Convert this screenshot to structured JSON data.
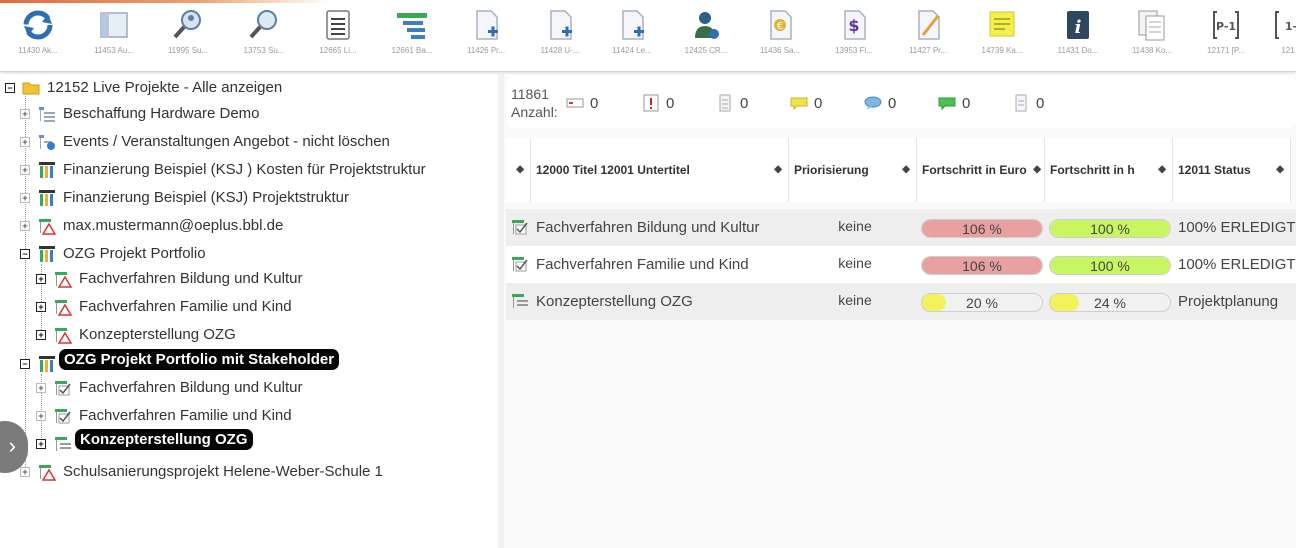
{
  "toolbar": {
    "buttons": [
      {
        "label": "11430 Ak...",
        "icon": "refresh-icon"
      },
      {
        "label": "11453 Au...",
        "icon": "window-icon"
      },
      {
        "label": "11995 Su...",
        "icon": "search-user-icon"
      },
      {
        "label": "13753 Su...",
        "icon": "search-icon"
      },
      {
        "label": "12665 Li...",
        "icon": "list-icon"
      },
      {
        "label": "12661 Ba...",
        "icon": "gantt-icon"
      },
      {
        "label": "11426 Pr...",
        "icon": "new-document-icon"
      },
      {
        "label": "11428 U-...",
        "icon": "new-document-icon"
      },
      {
        "label": "11424 Le...",
        "icon": "new-document-icon"
      },
      {
        "label": "12425 CR...",
        "icon": "user-add-icon"
      },
      {
        "label": "11436 Sa...",
        "icon": "euro-document-icon"
      },
      {
        "label": "13953 Fi...",
        "icon": "dollar-document-icon"
      },
      {
        "label": "11427 Pr...",
        "icon": "edit-document-icon"
      },
      {
        "label": "14739 Ka...",
        "icon": "sticky-note-icon"
      },
      {
        "label": "11431 Do...",
        "icon": "info-icon"
      },
      {
        "label": "11438 Ko...",
        "icon": "copy-documents-icon"
      },
      {
        "label": "12171 [P...",
        "icon": "p-1-icon"
      },
      {
        "label": "121",
        "icon": "bracket-icon"
      }
    ],
    "p1_text": "P-1",
    "bracket_text": "1-"
  },
  "tree": {
    "root": "12152 Live Projekte - Alle anzeigen",
    "items": [
      {
        "label": "Beschaffung Hardware Demo"
      },
      {
        "label": "Events / Veranstaltungen Angebot - nicht löschen"
      },
      {
        "label": "Finanzierung Beispiel (KSJ ) Kosten für Projektstruktur"
      },
      {
        "label": "Finanzierung Beispiel (KSJ) Projektstruktur"
      },
      {
        "label": "max.mustermann@oeplus.bbl.de"
      },
      {
        "label": "OZG Projekt Portfolio"
      },
      {
        "label": "Fachverfahren Bildung und Kultur"
      },
      {
        "label": "Fachverfahren Familie und Kind"
      },
      {
        "label": "Konzepterstellung OZG"
      },
      {
        "label": "OZG Projekt Portfolio mit Stakeholder"
      },
      {
        "label": "Fachverfahren Bildung und Kultur"
      },
      {
        "label": "Fachverfahren Familie und Kind"
      },
      {
        "label": "Konzepterstellung OZG"
      },
      {
        "label": "Schulsanierungsprojekt Helene-Weber-Schule 1"
      }
    ]
  },
  "summary": {
    "id": "11861",
    "count_label": "Anzahl:",
    "counts": [
      "0",
      "0",
      "0",
      "0",
      "0",
      "0",
      "0"
    ]
  },
  "grid": {
    "headers": [
      "12000 Titel 12001 Untertitel",
      "Priorisierung",
      "Fortschritt in Euro",
      "Fortschritt in h",
      "12011 Status"
    ],
    "rows": [
      {
        "title": "Fachverfahren Bildung und Kultur",
        "prio": "keine",
        "euro": "106 %",
        "euro_value": 106,
        "hours": "100 %",
        "hours_value": 100,
        "status": "100% ERLEDIGT"
      },
      {
        "title": "Fachverfahren Familie und Kind",
        "prio": "keine",
        "euro": "106 %",
        "euro_value": 106,
        "hours": "100 %",
        "hours_value": 100,
        "status": "100% ERLEDIGT"
      },
      {
        "title": "Konzepterstellung OZG",
        "prio": "keine",
        "euro": "20 %",
        "euro_value": 20,
        "hours": "24 %",
        "hours_value": 24,
        "status": "Projektplanung"
      }
    ]
  },
  "colors": {
    "over_budget": "#e8a0a0",
    "done": "#c8f562",
    "in_progress": "#f2f25a",
    "selected_bg": "#050505"
  }
}
